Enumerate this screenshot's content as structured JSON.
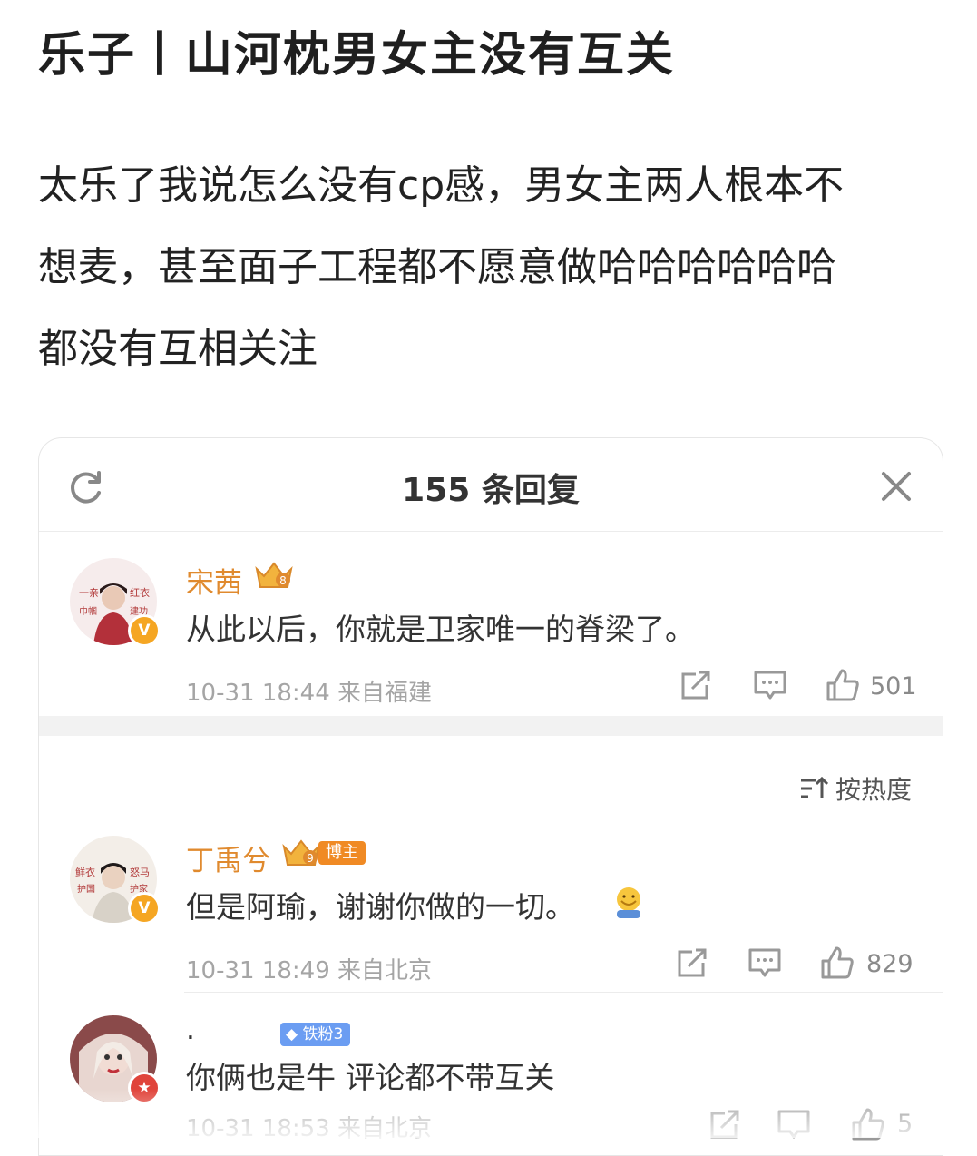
{
  "post": {
    "title": "乐子丨山河枕男女主没有互关",
    "body_lines": [
      "太乐了我说怎么没有cp感，男女主两人根本不",
      "想麦，甚至面子工程都不愿意做哈哈哈哈哈哈",
      "都没有互相关注"
    ]
  },
  "replies_panel": {
    "title": "155 条回复",
    "sort_label": "按热度",
    "comments": [
      {
        "username": "宋茜",
        "crown_level": "8",
        "text": "从此以后，你就是卫家唯一的脊梁了。",
        "meta": "10-31 18:44  来自福建",
        "likes": "501",
        "avatar_text": [
          "一亲",
          "红衣",
          "巾帼",
          "建功"
        ]
      },
      {
        "username": "丁禹兮",
        "crown_level": "9",
        "badge": "博主",
        "text": "但是阿瑜，谢谢你做的一切。",
        "meta": "10-31 18:49  来自北京",
        "likes": "829",
        "avatar_text": [
          "鲜衣",
          "怒马",
          "护国",
          "护家"
        ]
      },
      {
        "username": ".",
        "fan_badge": "铁粉3",
        "text": "你俩也是牛 评论都不带互关",
        "meta": "10-31 18:53  来自北京",
        "likes": "5"
      }
    ]
  },
  "colors": {
    "username": "#e08a2e",
    "meta": "#a5a5a5",
    "verified_gold": "#f5a623",
    "verified_red": "#e0443b",
    "fan_badge": "#6b9df2"
  },
  "icons": [
    "refresh-icon",
    "close-icon",
    "share-icon",
    "comment-icon",
    "like-icon",
    "sort-icon",
    "crown-icon",
    "smile-emoji-icon"
  ]
}
